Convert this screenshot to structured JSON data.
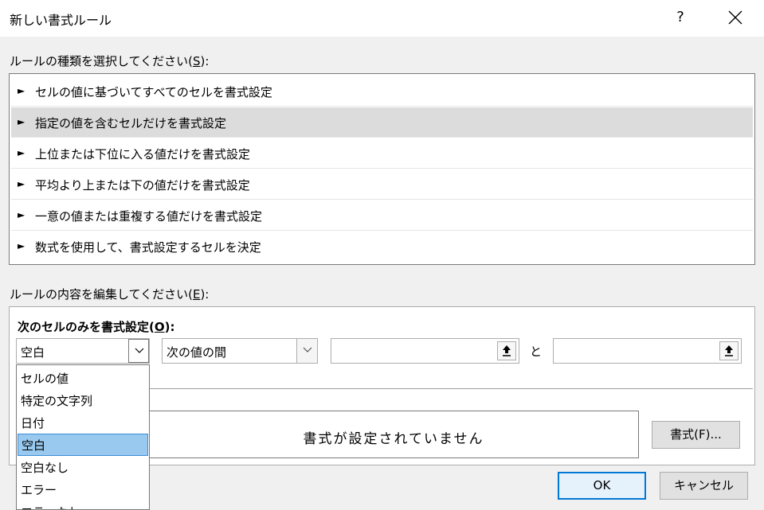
{
  "window": {
    "title": "新しい書式ルール",
    "help_label": "?",
    "close_label": "閉じる"
  },
  "rule_type": {
    "label": "ルールの種類を選択してください(",
    "accesskey": "S",
    "label_suffix": "):",
    "items": [
      {
        "label": "セルの値に基づいてすべてのセルを書式設定",
        "selected": false
      },
      {
        "label": "指定の値を含むセルだけを書式設定",
        "selected": true
      },
      {
        "label": "上位または下位に入る値だけを書式設定",
        "selected": false
      },
      {
        "label": "平均より上または下の値だけを書式設定",
        "selected": false
      },
      {
        "label": "一意の値または重複する値だけを書式設定",
        "selected": false
      },
      {
        "label": "数式を使用して、書式設定するセルを決定",
        "selected": false
      }
    ],
    "arrow": "►"
  },
  "rule_edit": {
    "label": "ルールの内容を編集してください(",
    "accesskey": "E",
    "label_suffix": "):",
    "heading": "次のセルのみを書式設定(",
    "heading_accesskey": "O",
    "heading_suffix": "):",
    "cell_condition": "空白",
    "operator": "次の値の間",
    "value1": "",
    "value2": "",
    "and_label": "と",
    "preview_text": "書式が設定されていません",
    "format_button": "書式(F)..."
  },
  "dropdown": {
    "items": [
      {
        "label": "セルの値",
        "highlighted": false
      },
      {
        "label": "特定の文字列",
        "highlighted": false
      },
      {
        "label": "日付",
        "highlighted": false
      },
      {
        "label": "空白",
        "highlighted": true
      },
      {
        "label": "空白なし",
        "highlighted": false
      },
      {
        "label": "エラー",
        "highlighted": false
      },
      {
        "label": "エラーなし",
        "highlighted": false
      }
    ]
  },
  "buttons": {
    "ok": "OK",
    "cancel": "キャンセル"
  },
  "colors": {
    "selection": "#dcdcdc",
    "dropdown_highlight": "#99c9ef",
    "focus_border": "#0078d7"
  }
}
